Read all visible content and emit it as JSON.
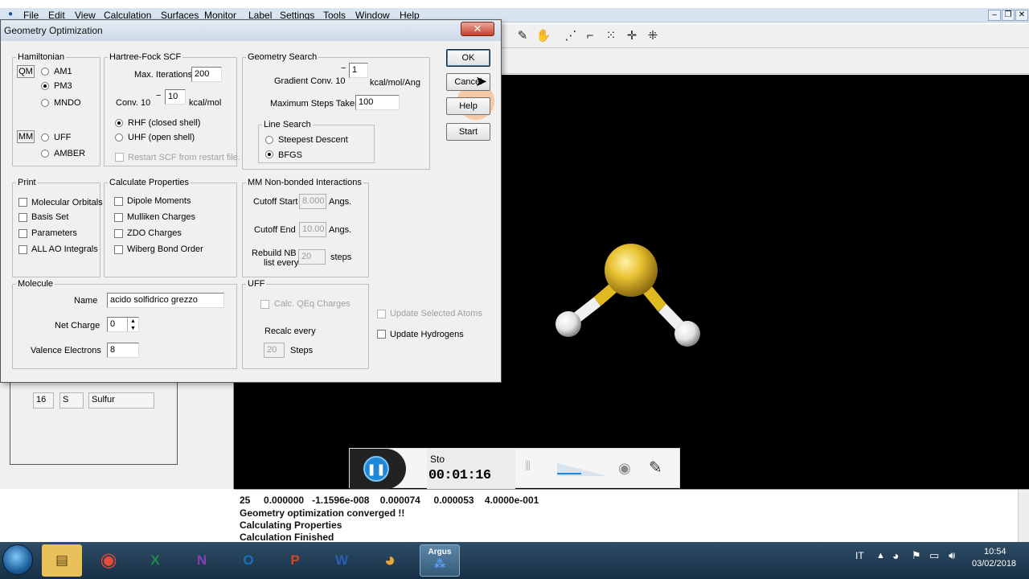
{
  "menubar": {
    "items": [
      "File",
      "Edit",
      "View",
      "Calculation",
      "Surfaces",
      "Monitor",
      "Label",
      "Settings",
      "Tools",
      "Window",
      "Help"
    ]
  },
  "dialog": {
    "title": "Geometry Optimization",
    "close_label": "✕",
    "hamiltonian": {
      "legend": "Hamiltonian",
      "qm_tag": "QM",
      "mm_tag": "MM",
      "options": [
        "AM1",
        "PM3",
        "MNDO",
        "UFF",
        "AMBER"
      ],
      "selected": "PM3"
    },
    "hartree_fock": {
      "legend": "Hartree-Fock SCF",
      "max_iter_label": "Max. Iterations",
      "max_iter_value": "200",
      "conv_label": "Conv. 10",
      "conv_exp_sign": "−",
      "conv_exp_value": "10",
      "conv_unit": "kcal/mol",
      "rhf_label": "RHF (closed shell)",
      "uhf_label": "UHF (open shell)",
      "restart_label": "Restart SCF from restart file."
    },
    "geometry_search": {
      "legend": "Geometry Search",
      "grad_label": "Gradient Conv. 10",
      "grad_exp_sign": "−",
      "grad_exp_value": "1",
      "grad_unit": "kcal/mol/Ang",
      "max_steps_label": "Maximum Steps Taken",
      "max_steps_value": "100",
      "line_search": {
        "legend": "Line Search",
        "steepest_label": "Steepest Descent",
        "bfgs_label": "BFGS"
      }
    },
    "buttons": {
      "ok": "OK",
      "cancel": "Cancel",
      "help": "Help",
      "start": "Start"
    },
    "print": {
      "legend": "Print",
      "items": [
        "Molecular Orbitals",
        "Basis Set",
        "Parameters",
        "ALL AO Integrals"
      ]
    },
    "calc_props": {
      "legend": "Calculate Properties",
      "items": [
        "Dipole Moments",
        "Mulliken Charges",
        "ZDO Charges",
        "Wiberg Bond Order"
      ]
    },
    "mm_nonbonded": {
      "legend": "MM Non-bonded Interactions",
      "cutoff_start_label": "Cutoff Start",
      "cutoff_start_value": "8.000",
      "cutoff_end_label": "Cutoff End",
      "cutoff_end_value": "10.00",
      "angs_label": "Angs.",
      "rebuild_label_1": "Rebuild NB",
      "rebuild_label_2": "list every",
      "rebuild_value": "20",
      "steps_label": "steps"
    },
    "molecule": {
      "legend": "Molecule",
      "name_label": "Name",
      "name_value": "acido solfidrico grezzo",
      "charge_label": "Net Charge",
      "charge_value": "0",
      "valence_label": "Valence Electrons",
      "valence_value": "8"
    },
    "uff": {
      "legend": "UFF",
      "calc_qeq_label": "Calc. QEq Charges",
      "recalc_label": "Recalc every",
      "recalc_value": "20",
      "steps_label": "Steps"
    },
    "update_selected_label": "Update Selected Atoms",
    "update_hydrogens_label": "Update Hydrogens"
  },
  "left_panel": {
    "element_number": "16",
    "element_symbol": "S",
    "element_name": "Sulfur"
  },
  "recorder": {
    "status": "Sto",
    "time": "00:01:16"
  },
  "output": {
    "lines": [
      "25     0.000000   -1.1596e-008    0.000074     0.000053    4.0000e-001",
      "Geometry optimization converged !!",
      "Calculating Properties",
      "Calculation Finished"
    ]
  },
  "taskbar": {
    "language": "IT",
    "time": "10:54",
    "date": "03/02/2018",
    "argus_label": "Argus"
  },
  "colors": {
    "sulfur": "#e8c232",
    "hydrogen": "#f2f2f2",
    "dialog_close": "#c7402a"
  }
}
